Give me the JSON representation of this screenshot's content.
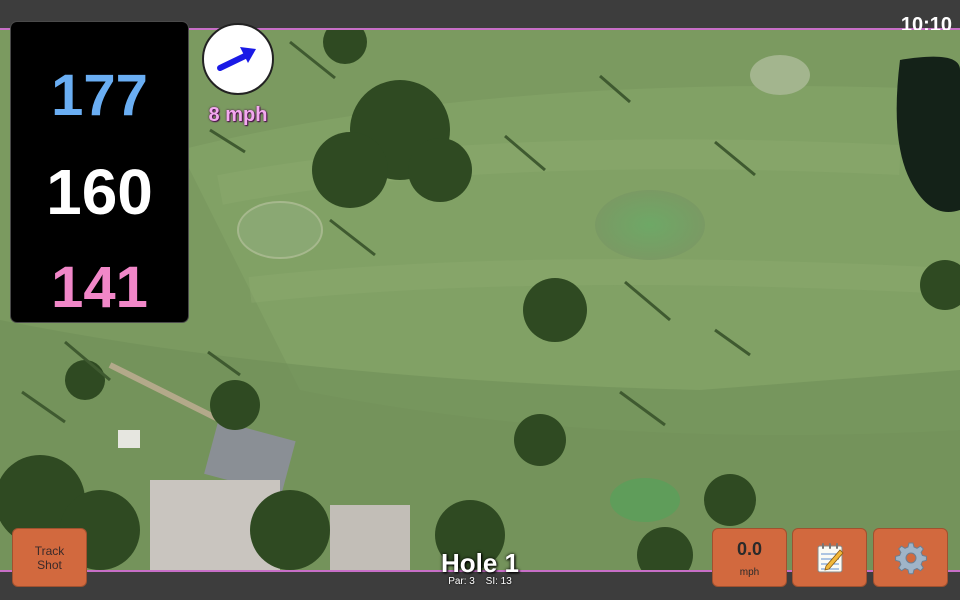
{
  "status_bar": {
    "time": "10:10"
  },
  "distances": {
    "back": "177",
    "middle": "160",
    "front": "141"
  },
  "wind": {
    "speed_label": "8 mph",
    "direction_icon": "arrow-northeast-icon",
    "arrow_color": "#1a1ae6"
  },
  "hole": {
    "title": "Hole 1",
    "par_label": "Par: 3",
    "si_label": "SI: 13"
  },
  "buttons": {
    "track_shot": "Track Shot",
    "speed_value": "0.0",
    "speed_unit": "mph",
    "notes_icon": "notepad-icon",
    "settings_icon": "gear-icon"
  },
  "colors": {
    "accent_line": "#c76fc7",
    "button_bg": "#d2693e",
    "back_distance": "#6aaef3",
    "front_distance": "#f187c8"
  }
}
